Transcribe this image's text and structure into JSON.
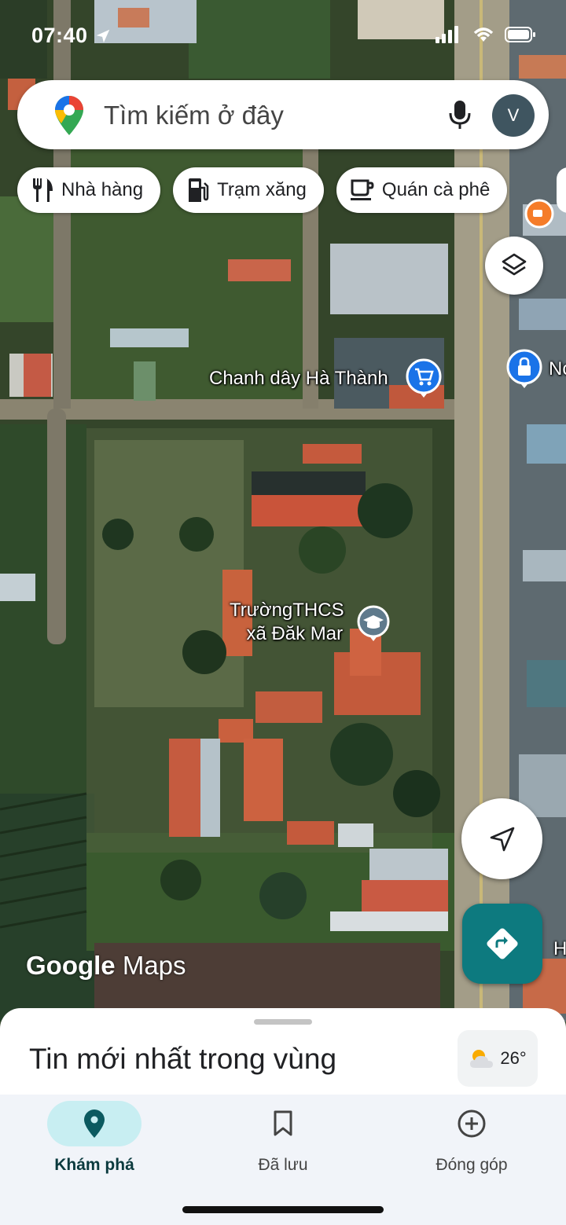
{
  "status_bar": {
    "time": "07:40"
  },
  "search": {
    "placeholder": "Tìm kiếm ở đây",
    "avatar_letter": "V"
  },
  "chips": [
    {
      "label": "Nhà hàng",
      "icon": "restaurant-icon"
    },
    {
      "label": "Trạm xăng",
      "icon": "gas-station-icon"
    },
    {
      "label": "Quán cà phê",
      "icon": "coffee-icon"
    }
  ],
  "map": {
    "poi_shop": "Chanh dây Hà Thành",
    "poi_school_line1": "TrườngTHCS",
    "poi_school_line2": "xã Đăk Mar",
    "edge_label_1": "Nc",
    "edge_label_2": "H",
    "watermark_google": "Google",
    "watermark_maps": "Maps"
  },
  "sheet": {
    "title": "Tin mới nhất trong vùng",
    "temperature": "26°"
  },
  "nav": {
    "explore": "Khám phá",
    "saved": "Đã lưu",
    "contribute": "Đóng góp"
  },
  "colors": {
    "accent": "#0d7a7f",
    "explore_pill": "#c8eef2",
    "shop_pin": "#1a73e8",
    "school_pin": "#5f7a8c"
  }
}
